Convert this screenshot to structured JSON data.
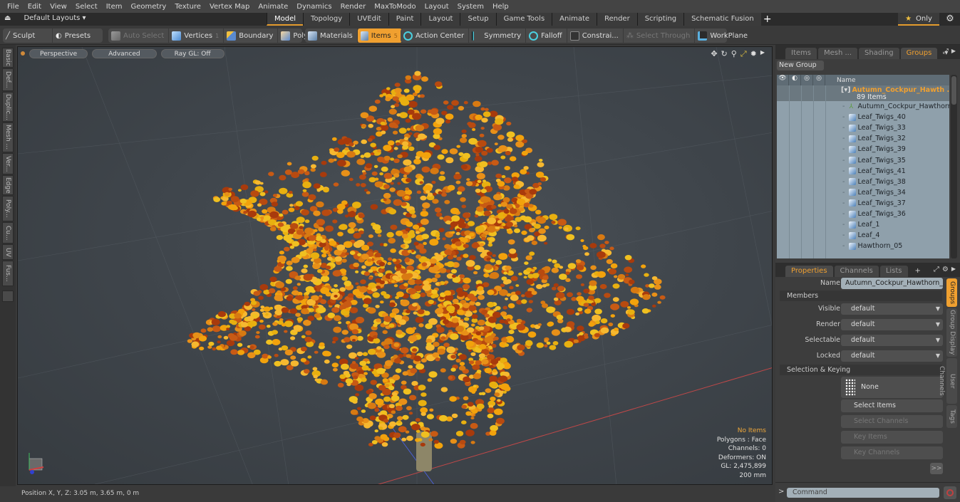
{
  "menubar": [
    "File",
    "Edit",
    "View",
    "Select",
    "Item",
    "Geometry",
    "Texture",
    "Vertex Map",
    "Animate",
    "Dynamics",
    "Render",
    "MaxToModo",
    "Layout",
    "System",
    "Help"
  ],
  "layoutbar": {
    "layouts_label": "Default Layouts ▾",
    "tabs": [
      "Model",
      "Topology",
      "UVEdit",
      "Paint",
      "Layout",
      "Setup",
      "Game Tools",
      "Animate",
      "Render",
      "Scripting",
      "Schematic Fusion"
    ],
    "active_tab": "Model",
    "add_tab": "+",
    "only_label": "Only"
  },
  "toolbar": {
    "sculpt": "Sculpt",
    "presets": "Presets",
    "auto_select": "Auto Select",
    "vertices": "Vertices",
    "vertices_count": "1",
    "boundary": "Boundary",
    "polygons": "Polygons",
    "materials": "Materials",
    "items": "Items",
    "items_count": "5",
    "action_center": "Action Center",
    "symmetry": "Symmetry",
    "falloff": "Falloff",
    "constraints": "Constrai...",
    "select_through": "Select Through",
    "workplane": "WorkPlane"
  },
  "left_tabs": [
    "Basic",
    "Def...",
    "Duplic...",
    "Mesh ...",
    "Ver...",
    "Edge",
    "Poly...",
    "Cu...",
    "UV",
    "Fus..."
  ],
  "viewport": {
    "view_mode": "Perspective",
    "shading": "Advanced",
    "raygl": "Ray GL: Off",
    "stats": {
      "selection": "No Items",
      "polygons": "Polygons : Face",
      "channels": "Channels: 0",
      "deformers": "Deformers: ON",
      "gl": "GL: 2,475,899",
      "grid": "200 mm"
    }
  },
  "statusbar": {
    "position": "Position X, Y, Z:   3.05 m, 3.65 m, 0 m"
  },
  "groups_panel": {
    "tabs": [
      "Items",
      "Mesh ...",
      "Shading",
      "Groups"
    ],
    "active_tab": "Groups",
    "new_group": "New Group",
    "column_name": "Name",
    "group": {
      "name": "Autumn_Cockpur_Hawth ...",
      "count": "89 Items"
    },
    "items": [
      {
        "name": "Autumn_Cockpur_Hawthorn...",
        "type": "locator"
      },
      {
        "name": "Leaf_Twigs_40",
        "type": "mesh"
      },
      {
        "name": "Leaf_Twigs_33",
        "type": "mesh"
      },
      {
        "name": "Leaf_Twigs_32",
        "type": "mesh"
      },
      {
        "name": "Leaf_Twigs_39",
        "type": "mesh"
      },
      {
        "name": "Leaf_Twigs_35",
        "type": "mesh"
      },
      {
        "name": "Leaf_Twigs_41",
        "type": "mesh"
      },
      {
        "name": "Leaf_Twigs_38",
        "type": "mesh"
      },
      {
        "name": "Leaf_Twigs_34",
        "type": "mesh"
      },
      {
        "name": "Leaf_Twigs_37",
        "type": "mesh"
      },
      {
        "name": "Leaf_Twigs_36",
        "type": "mesh"
      },
      {
        "name": "Leaf_1",
        "type": "mesh"
      },
      {
        "name": "Leaf_4",
        "type": "mesh"
      },
      {
        "name": "Hawthorn_05",
        "type": "mesh"
      }
    ]
  },
  "properties_panel": {
    "tabs": [
      "Properties",
      "Channels",
      "Lists"
    ],
    "active_tab": "Properties",
    "add_tab": "+",
    "name_label": "Name",
    "name_value": "Autumn_Cockpur_Hawthorn_with",
    "members_section": "Members",
    "members": [
      {
        "label": "Visible",
        "value": "default"
      },
      {
        "label": "Render",
        "value": "default"
      },
      {
        "label": "Selectable",
        "value": "default"
      },
      {
        "label": "Locked",
        "value": "default"
      }
    ],
    "keying_section": "Selection & Keying",
    "none_btn": "None",
    "select_items": "Select Items",
    "select_channels": "Select Channels",
    "key_items": "Key Items",
    "key_channels": "Key Channels",
    "more": ">>",
    "side_tabs": [
      "Groups",
      "Group Display",
      "User Channels",
      "Tags"
    ],
    "active_side_tab": "Groups"
  },
  "command": {
    "placeholder": "Command",
    "prompt": ">"
  },
  "colors": {
    "accent": "#f0a030",
    "viewport_bg": "#40464c",
    "list_bg": "#8fa0ab"
  }
}
